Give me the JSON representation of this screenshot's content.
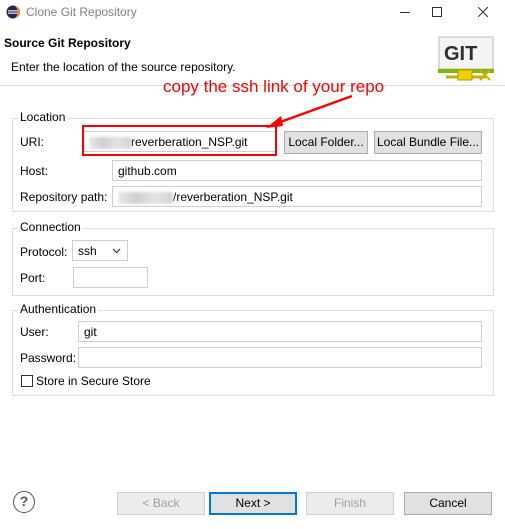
{
  "window": {
    "title": "Clone Git Repository",
    "minimize_icon": "minimize-icon",
    "maximize_icon": "maximize-icon",
    "close_icon": "close-icon"
  },
  "header": {
    "title": "Source Git Repository",
    "description": "Enter the location of the source repository.",
    "logo_text": "GIT"
  },
  "annotation": {
    "text": "copy the ssh link of your repo",
    "color": "#ff0000"
  },
  "location": {
    "group_label": "Location",
    "uri_label": "URI:",
    "uri_value": "reverberation_NSP.git",
    "local_folder_label": "Local Folder...",
    "local_bundle_label": "Local Bundle File...",
    "host_label": "Host:",
    "host_value": "github.com",
    "repo_path_label": "Repository path:",
    "repo_path_value": "/reverberation_NSP.git"
  },
  "connection": {
    "group_label": "Connection",
    "protocol_label": "Protocol:",
    "protocol_value": "ssh",
    "port_label": "Port:",
    "port_value": ""
  },
  "authentication": {
    "group_label": "Authentication",
    "user_label": "User:",
    "user_value": "git",
    "password_label": "Password:",
    "password_value": "",
    "secure_store_label": "Store in Secure Store"
  },
  "footer": {
    "help_symbol": "?",
    "back_label": "< Back",
    "next_label": "Next >",
    "finish_label": "Finish",
    "cancel_label": "Cancel"
  }
}
